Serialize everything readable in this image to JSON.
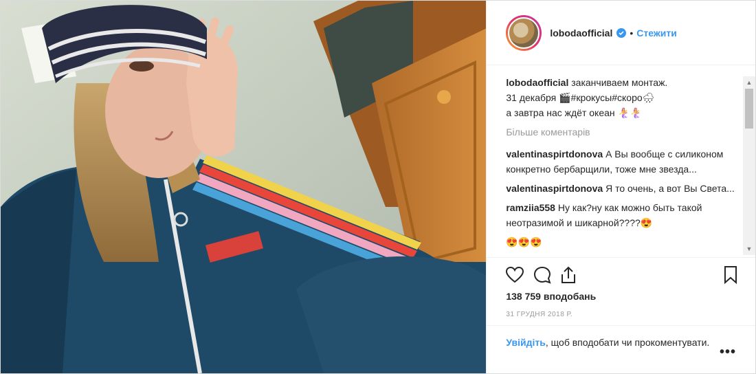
{
  "post": {
    "username": "lobodaofficial",
    "dot": "•",
    "follow_label": "Стежити",
    "caption": {
      "user": "lobodaofficial",
      "line1": "заканчиваем монтаж.",
      "line2": "31 декабря 🎬#крокусы#скоро🌧",
      "line3": "а завтра нас ждёт океан 🧜‍♀️🧜‍♀️"
    },
    "more_comments": "Більше коментарів",
    "comments": [
      {
        "user": "valentinaspirtdonova",
        "text": "А Вы вообще с силиконом конкретно бербарщили, тоже мне звезда..."
      },
      {
        "user": "valentinaspirtdonova",
        "text": "Я то очень, а вот Вы Света..."
      },
      {
        "user": "ramziia558",
        "text": "Ну как?ну как можно быть такой неотразимой и шикарной????😍"
      }
    ],
    "partial_emojis": "😍😍😍",
    "likes": "138 759 вподобань",
    "date": "31 ГРУДНЯ 2018 Р.",
    "footer": {
      "login_link": "Увійдіть",
      "rest": ", щоб вподобати чи прокоментувати."
    },
    "more_icon": "•••"
  },
  "icons": {
    "like": "heart-icon",
    "comment": "comment-icon",
    "share": "share-icon",
    "save": "bookmark-icon",
    "verified": "verified-badge-icon"
  },
  "colors": {
    "link_blue": "#3897f0",
    "verified_blue": "#3897f0",
    "muted": "#999999"
  }
}
